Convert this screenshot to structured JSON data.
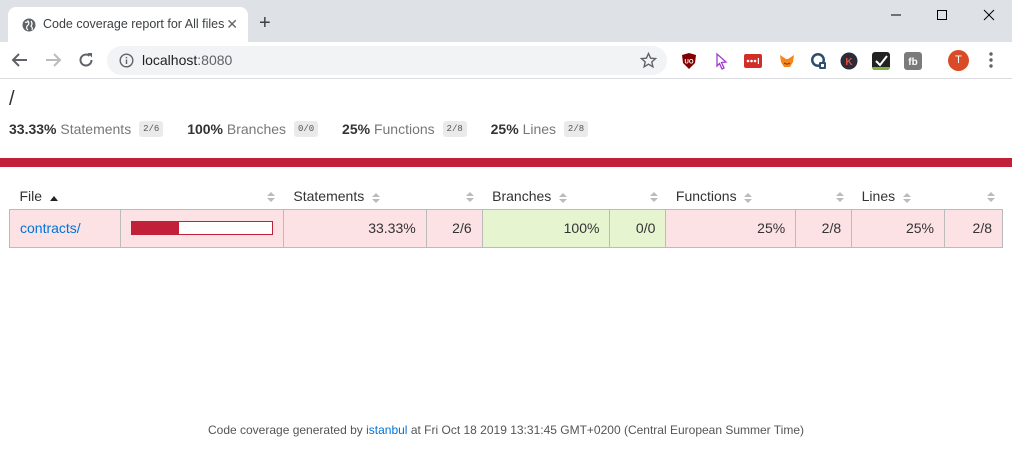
{
  "browser": {
    "tab_title": "Code coverage report for All files",
    "url_host": "localhost",
    "url_port": ":8080",
    "profile_initial": "T"
  },
  "page": {
    "heading": "/",
    "summary": [
      {
        "pct": "33.33%",
        "label": "Statements",
        "fraction": "2/6"
      },
      {
        "pct": "100%",
        "label": "Branches",
        "fraction": "0/0"
      },
      {
        "pct": "25%",
        "label": "Functions",
        "fraction": "2/8"
      },
      {
        "pct": "25%",
        "label": "Lines",
        "fraction": "2/8"
      }
    ],
    "status_color": "#c21f39",
    "table": {
      "headers": {
        "file": "File",
        "statements": "Statements",
        "branches": "Branches",
        "functions": "Functions",
        "lines": "Lines"
      },
      "rows": [
        {
          "file": "contracts/",
          "coverage_fraction": 0.3333,
          "statements_pct": "33.33%",
          "statements_frac": "2/6",
          "branches_pct": "100%",
          "branches_frac": "0/0",
          "functions_pct": "25%",
          "functions_frac": "2/8",
          "lines_pct": "25%",
          "lines_frac": "2/8"
        }
      ]
    },
    "footer": {
      "prefix": "Code coverage generated by",
      "link": "istanbul",
      "suffix": "at Fri Oct 18 2019 13:31:45 GMT+0200 (Central European Summer Time)"
    }
  },
  "colors": {
    "low": "#fce1e5",
    "high": "#e6f5d0",
    "link": "#0074d9"
  },
  "icons": [
    "globe-icon",
    "close-icon",
    "plus-icon",
    "minimize-icon",
    "maximize-icon",
    "window-close-icon",
    "back-arrow-icon",
    "forward-arrow-icon",
    "reload-icon",
    "info-icon",
    "star-icon",
    "ublock-icon",
    "cursor-extension-icon",
    "lastpass-icon",
    "metamask-icon",
    "lock-extension-icon",
    "k-extension-icon",
    "checkmark-extension-icon",
    "fb-extension-icon",
    "menu-dots-icon",
    "sort-icon",
    "sort-asc-icon"
  ]
}
